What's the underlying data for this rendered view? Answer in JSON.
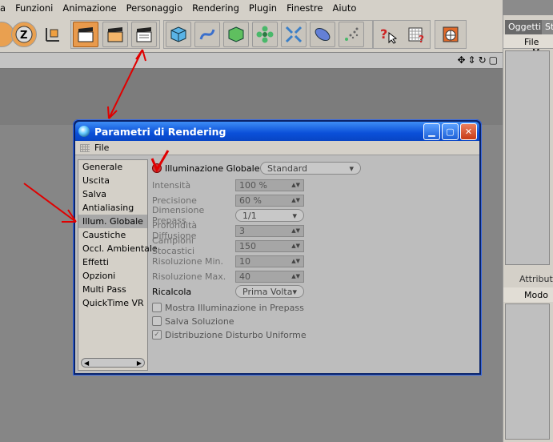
{
  "menubar": {
    "items": [
      "a",
      "Funzioni",
      "Animazione",
      "Personaggio",
      "Rendering",
      "Plugin",
      "Finestre",
      "Aiuto"
    ]
  },
  "right_panel": {
    "tab_oggetti": "Oggetti",
    "tab_other": "St",
    "file_label": "File",
    "file_extra": "M",
    "attributi_label": "Attributi",
    "modo_label": "Modo"
  },
  "dialog": {
    "title": "Parametri di Rendering",
    "menu_file": "File",
    "categories": [
      "Generale",
      "Uscita",
      "Salva",
      "Antialiasing",
      "Illum. Globale",
      "Caustiche",
      "Occl. Ambientale",
      "Effetti",
      "Opzioni",
      "Multi Pass",
      "QuickTime VR"
    ],
    "selected_category": "Illum. Globale",
    "gi_label": "Illuminazione Globale",
    "gi_mode": "Standard",
    "intensita_label": "Intensità",
    "intensita_value": "100 %",
    "precisione_label": "Precisione",
    "precisione_value": "60 %",
    "prepass_label": "Dimensione Prepass",
    "prepass_value": "1/1",
    "profondita_label": "Profondità Diffusione",
    "profondita_value": "3",
    "campioni_label": "Campioni Stocastici",
    "campioni_value": "150",
    "rismin_label": "Risoluzione Min.",
    "rismin_value": "10",
    "rismax_label": "Risoluzione Max.",
    "rismax_value": "40",
    "ricalcola_label": "Ricalcola",
    "ricalcola_value": "Prima Volta",
    "chk_mostra": "Mostra Illuminazione in Prepass",
    "chk_salva": "Salva Soluzione",
    "chk_distribuzione": "Distribuzione Disturbo Uniforme"
  },
  "colors": {
    "annotation": "#e00000",
    "titlebar": "#0a4fd8",
    "highlight_button": "#e99a4c"
  }
}
